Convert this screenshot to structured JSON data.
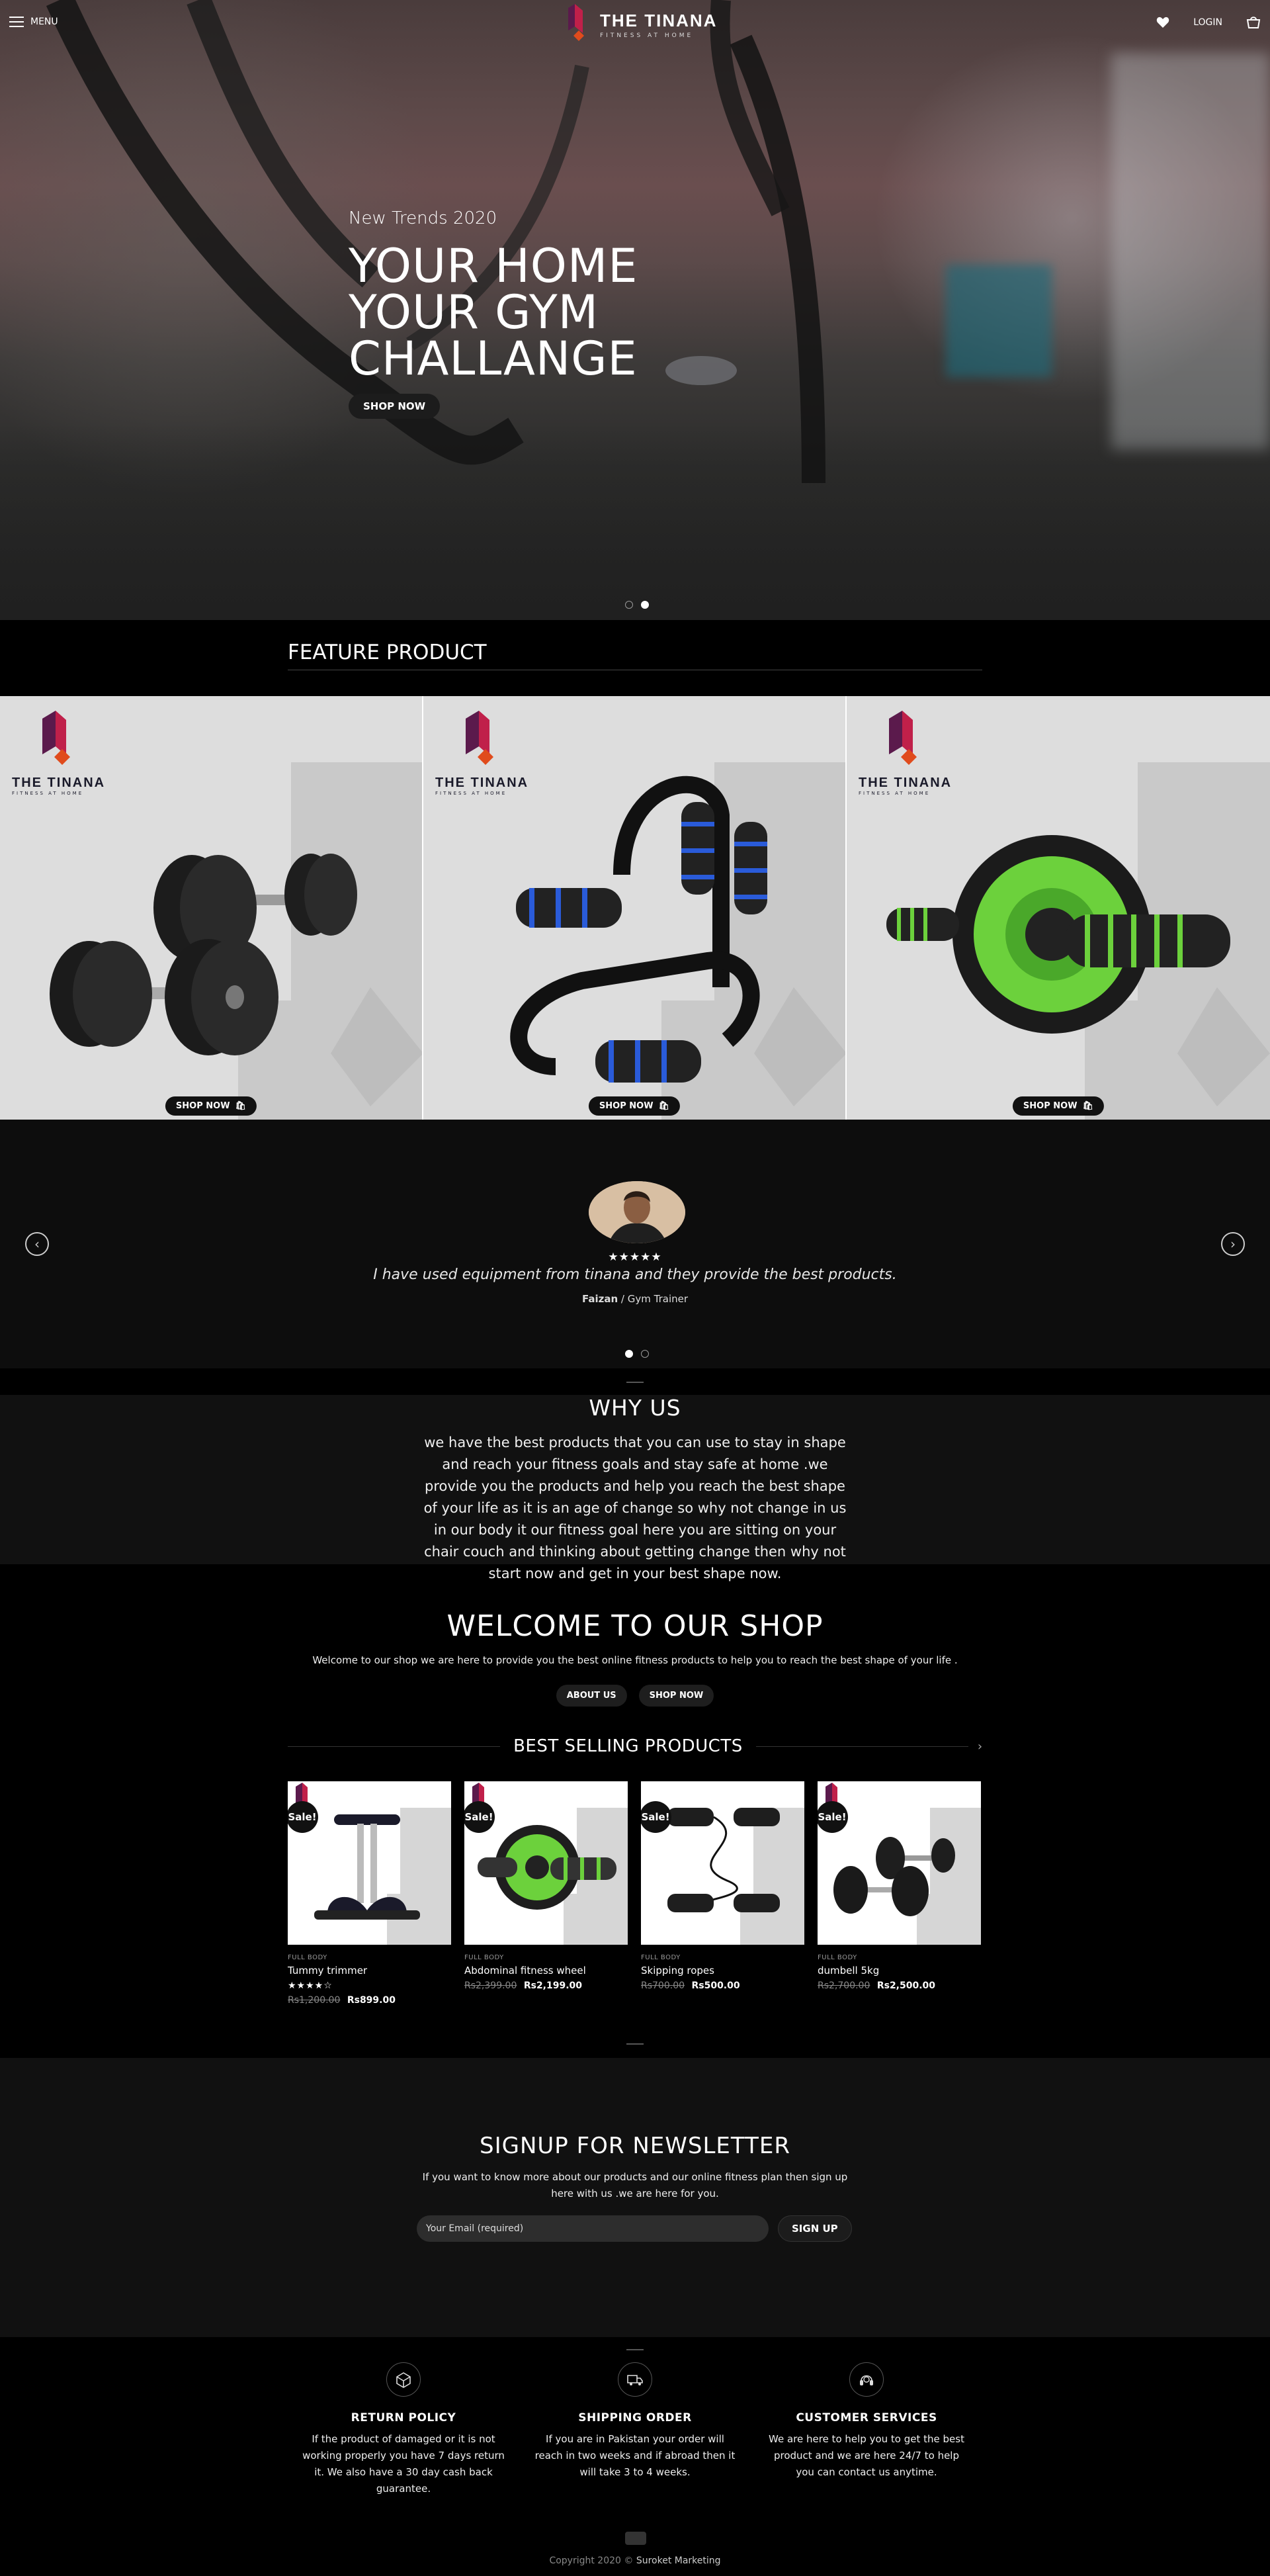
{
  "header": {
    "menu_label": "MENU",
    "brand_name": "THE TINANA",
    "brand_tagline": "FITNESS AT HOME",
    "login_label": "LOGIN",
    "icons": [
      "menu-icon",
      "heart-icon",
      "cart-icon"
    ]
  },
  "hero": {
    "kicker": "New Trends 2020",
    "title_lines": [
      "YOUR HOME",
      "YOUR GYM",
      "CHALLANGE"
    ],
    "button": "SHOP NOW",
    "active_slide": 2,
    "slide_count": 2
  },
  "feature": {
    "heading": "FEATURE PRODUCT",
    "cards": [
      {
        "logo_name": "THE TINANA",
        "logo_tag": "FITNESS AT HOME",
        "button": "SHOP NOW",
        "product": "dumbbells"
      },
      {
        "logo_name": "THE TINANA",
        "logo_tag": "FITNESS AT HOME",
        "button": "SHOP NOW",
        "product": "push-up bars"
      },
      {
        "logo_name": "THE TINANA",
        "logo_tag": "FITNESS AT HOME",
        "button": "SHOP NOW",
        "product": "ab wheel"
      }
    ]
  },
  "testimonial": {
    "stars": "★★★★★",
    "quote": "I have used equipment from tinana and they provide the best products.",
    "author": "Faizan",
    "role": "/ Gym Trainer"
  },
  "why": {
    "heading": "WHY US",
    "body": "we have the best products that you can use to stay in shape and reach your fitness goals and stay safe at home .we provide you the products and help you reach the best shape of your life as it is an age of change so why not change in us in our body it our fitness goal here you are sitting on your chair couch and thinking about getting change then why not start now and get in your best shape now."
  },
  "welcome": {
    "heading": "WELCOME TO OUR SHOP",
    "text": "Welcome to our shop we are here to provide you the best online fitness products to help you to reach the best shape of your life .",
    "about_btn": "ABOUT US",
    "shop_btn": "SHOP NOW"
  },
  "best_selling": {
    "heading": "BEST SELLING PRODUCTS",
    "products": [
      {
        "sale": "Sale!",
        "category": "FULL BODY",
        "name": "Tummy trimmer",
        "rating": "★★★★☆",
        "old_price": "Rs1,200.00",
        "price": "Rs899.00"
      },
      {
        "sale": "Sale!",
        "category": "FULL BODY",
        "name": "Abdominal fitness wheel",
        "rating": "",
        "old_price": "Rs2,399.00",
        "price": "Rs2,199.00"
      },
      {
        "sale": "Sale!",
        "category": "FULL BODY",
        "name": "Skipping ropes",
        "rating": "",
        "old_price": "Rs700.00",
        "price": "Rs500.00"
      },
      {
        "sale": "Sale!",
        "category": "FULL BODY",
        "name": "dumbell 5kg",
        "rating": "",
        "old_price": "Rs2,700.00",
        "price": "Rs2,500.00"
      }
    ]
  },
  "newsletter": {
    "heading": "SIGNUP FOR NEWSLETTER",
    "text": "If you want to know more about our products and our online fitness plan then sign up here with us .we are here for you.",
    "placeholder": "Your Email (required)",
    "button": "SIGN UP"
  },
  "footer_features": [
    {
      "icon": "package-icon",
      "title": "RETURN POLICY",
      "text": "If the product of damaged or it is not working properly you have 7 days return it. We also have a 30 day cash back guarantee."
    },
    {
      "icon": "truck-icon",
      "title": "SHIPPING ORDER",
      "text": "If you are in Pakistan your order will reach in two weeks and if abroad then it will take 3 to 4 weeks."
    },
    {
      "icon": "headset-icon",
      "title": "CUSTOMER SERVICES",
      "text": "We are here to help you to get the best product and we are here 24/7 to help you can contact us anytime."
    }
  ],
  "footer": {
    "copyright_prefix": "Copyright 2020 ©",
    "company": "Suroket Marketing"
  },
  "colors": {
    "brand_red": "#c0204a",
    "brand_purple": "#5b1a4c",
    "brand_orange": "#e04b1c",
    "wheel_green": "#6cd13c",
    "pushup_blue": "#2a5bd9"
  }
}
